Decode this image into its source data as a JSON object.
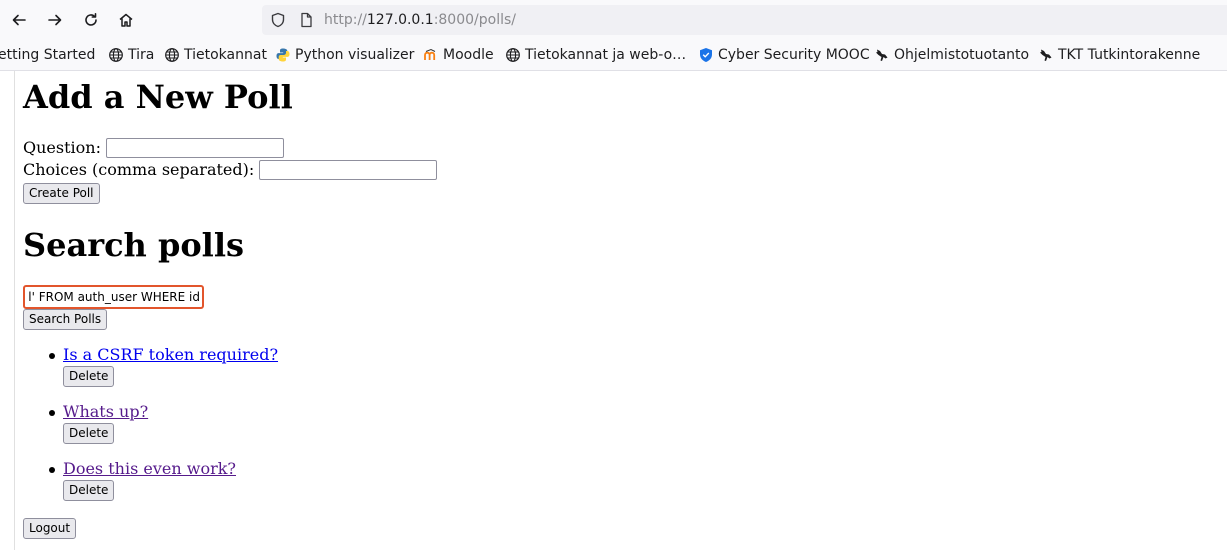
{
  "browser": {
    "url_prefix": "http://",
    "url_host": "127.0.0.1",
    "url_rest": ":8000/polls/",
    "bookmarks": [
      {
        "label": "etting Started",
        "icon": "none"
      },
      {
        "label": "Tira",
        "icon": "globe-icon"
      },
      {
        "label": "Tietokannat",
        "icon": "globe-icon"
      },
      {
        "label": "Python visualizer",
        "icon": "python-icon"
      },
      {
        "label": "Moodle",
        "icon": "moodle-icon"
      },
      {
        "label": "Tietokannat ja web-o…",
        "icon": "globe-icon"
      },
      {
        "label": "Cyber Security MOOC",
        "icon": "shield-icon"
      },
      {
        "label": "Ohjelmistotuotanto",
        "icon": "kangaroo-icon"
      },
      {
        "label": "TKT Tutkintorakenne",
        "icon": "kangaroo-icon"
      }
    ]
  },
  "add_poll": {
    "heading": "Add a New Poll",
    "question_label": "Question:",
    "question_value": "",
    "choices_label": "Choices (comma separated):",
    "choices_value": "",
    "submit_label": "Create Poll"
  },
  "search": {
    "heading": "Search polls",
    "query_visible": "l' FROM auth_user WHERE id",
    "submit_label": "Search Polls"
  },
  "polls": [
    {
      "title": "Is a CSRF token required?",
      "visited": false,
      "delete_label": "Delete"
    },
    {
      "title": "Whats up?",
      "visited": true,
      "delete_label": "Delete"
    },
    {
      "title": "Does this even work?",
      "visited": true,
      "delete_label": "Delete"
    }
  ],
  "logout_label": "Logout",
  "colors": {
    "link": "#0000ee",
    "visited_link": "#551a8b",
    "focus_ring": "#e2552c"
  }
}
